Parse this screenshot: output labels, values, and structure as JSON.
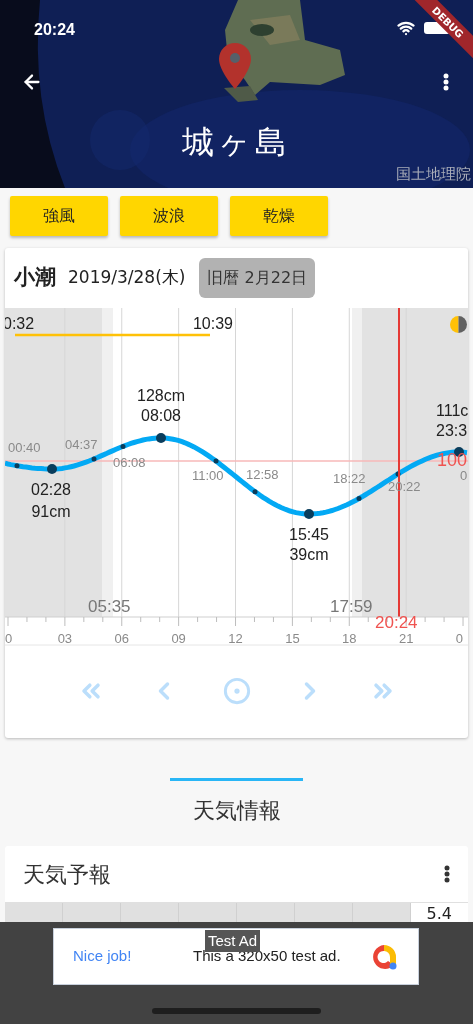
{
  "status_bar": {
    "time": "20:24"
  },
  "debug_banner": "DEBUG",
  "header": {
    "title": "城ヶ島",
    "credit": "国土地理院"
  },
  "tags": [
    "強風",
    "波浪",
    "乾燥"
  ],
  "tide_card": {
    "tide_name": "小潮",
    "date": "2019/3/28(木)",
    "lunar_date": "旧暦 2月22日",
    "chart": {
      "labels": [
        {
          "text": "0:32",
          "kind": "moon_time"
        },
        {
          "text": "10:39",
          "kind": "moon_time"
        },
        {
          "text": "128cm",
          "kind": "extreme"
        },
        {
          "text": "08:08",
          "kind": "extreme"
        },
        {
          "text": "111c",
          "kind": "extreme"
        },
        {
          "text": "23:3",
          "kind": "extreme"
        },
        {
          "text": "00:40",
          "kind": "time"
        },
        {
          "text": "04:37",
          "kind": "time"
        },
        {
          "text": "06:08",
          "kind": "time"
        },
        {
          "text": "11:00",
          "kind": "time"
        },
        {
          "text": "12:58",
          "kind": "time"
        },
        {
          "text": "18:22",
          "kind": "time"
        },
        {
          "text": "20:22",
          "kind": "time"
        },
        {
          "text": "100",
          "kind": "level"
        },
        {
          "text": "0",
          "kind": "time"
        },
        {
          "text": "02:28",
          "kind": "extreme"
        },
        {
          "text": "91cm",
          "kind": "extreme"
        },
        {
          "text": "15:45",
          "kind": "extreme"
        },
        {
          "text": "39cm",
          "kind": "extreme"
        },
        {
          "text": "05:35",
          "kind": "sun"
        },
        {
          "text": "17:59",
          "kind": "sun"
        },
        {
          "text": "20:24",
          "kind": "now"
        }
      ],
      "axis_ticks": [
        "0",
        "03",
        "06",
        "09",
        "12",
        "15",
        "18",
        "21",
        "0"
      ]
    }
  },
  "section_tab": {
    "label": "天気情報",
    "selected": true
  },
  "weather_card": {
    "title": "天気予報",
    "value": "5.4"
  },
  "ad": {
    "badge": "Test Ad",
    "headline": "Nice job!",
    "text": "This a 320x50 test ad."
  }
}
